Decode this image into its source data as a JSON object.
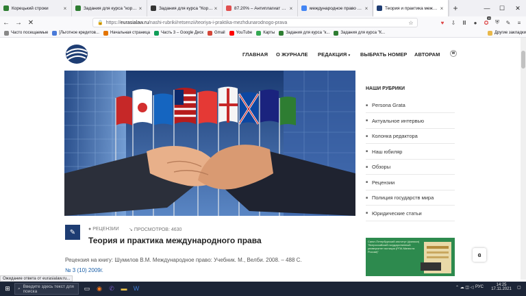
{
  "browser": {
    "tabs": [
      {
        "title": "Корецький строки",
        "color": "#2e7d32",
        "active": false
      },
      {
        "title": "Задания для курса \"корецы",
        "color": "#2e7d32",
        "active": false
      },
      {
        "title": "Задания для курса \"Корецы",
        "color": "#333333",
        "active": false
      },
      {
        "title": "87.20% – Антиплагиат онлай",
        "color": "#e04f4f",
        "active": false
      },
      {
        "title": "международное право – Goo",
        "color": "#4285f4",
        "active": false
      },
      {
        "title": "Теория и практика междуна",
        "color": "#1e3d73",
        "active": true
      }
    ],
    "url_prefix": "https://",
    "url_host": "eurasialaw.ru",
    "url_path": "/nashi-rubriki/retsenzii/teoriya-i-praktika-mezhdunarodnogo-prava",
    "bookmarks": [
      "Часто посещаемые",
      "[Льготное кредитов...",
      "Начальная страница",
      "Часть 3 – Google Диск",
      "Gmail",
      "YouTube",
      "Карты",
      "Задания для курса \"к...",
      "Задания для курса \"К..."
    ],
    "other_bookmarks": "Другие закладки",
    "ext_badge": "10",
    "status": "Ожидание ответа от eurasialaw.ru..."
  },
  "site": {
    "nav": [
      "ГЛАВНАЯ",
      "О ЖУРНАЛЕ",
      "РЕДАКЦИЯ",
      "ВЫБРАТЬ НОМЕР",
      "АВТОРАМ"
    ],
    "nav_dropdown_icon": "chevron-down-icon",
    "logo_icon": "globe-logo-icon",
    "sidebar": {
      "title": "НАШИ РУБРИКИ",
      "items": [
        "Persona Grata",
        "Актуальное интервью",
        "Колонка редактора",
        "Наш юбиляр",
        "Обзоры",
        "Рецензии",
        "Полиция государств мира",
        "Юридические статьи"
      ]
    },
    "article": {
      "category": "РЕЦЕНЗИИ",
      "views": "ПРОСМОТРОВ: 4630",
      "title": "Теория и практика международного права",
      "text": "Рецензия на книгу: Шумилов В.М. Международное право: Учебник. М., Велби. 2008. – 488 С.",
      "issue": "№ 3 (10) 2009г."
    },
    "ad_text": "Санкт-Петербургский институт (филиал) \"Всероссийский государственный университет юстиции (РПА Минюста России)\"",
    "fab_label": "ɞ"
  },
  "taskbar": {
    "search_placeholder": "Введите здесь текст для поиска",
    "lang": "РУС",
    "time": "14:25",
    "date": "17.11.2021"
  },
  "colors": {
    "accent": "#1e3d73",
    "link": "#1a5fa8",
    "taskbar": "#1c2537"
  }
}
